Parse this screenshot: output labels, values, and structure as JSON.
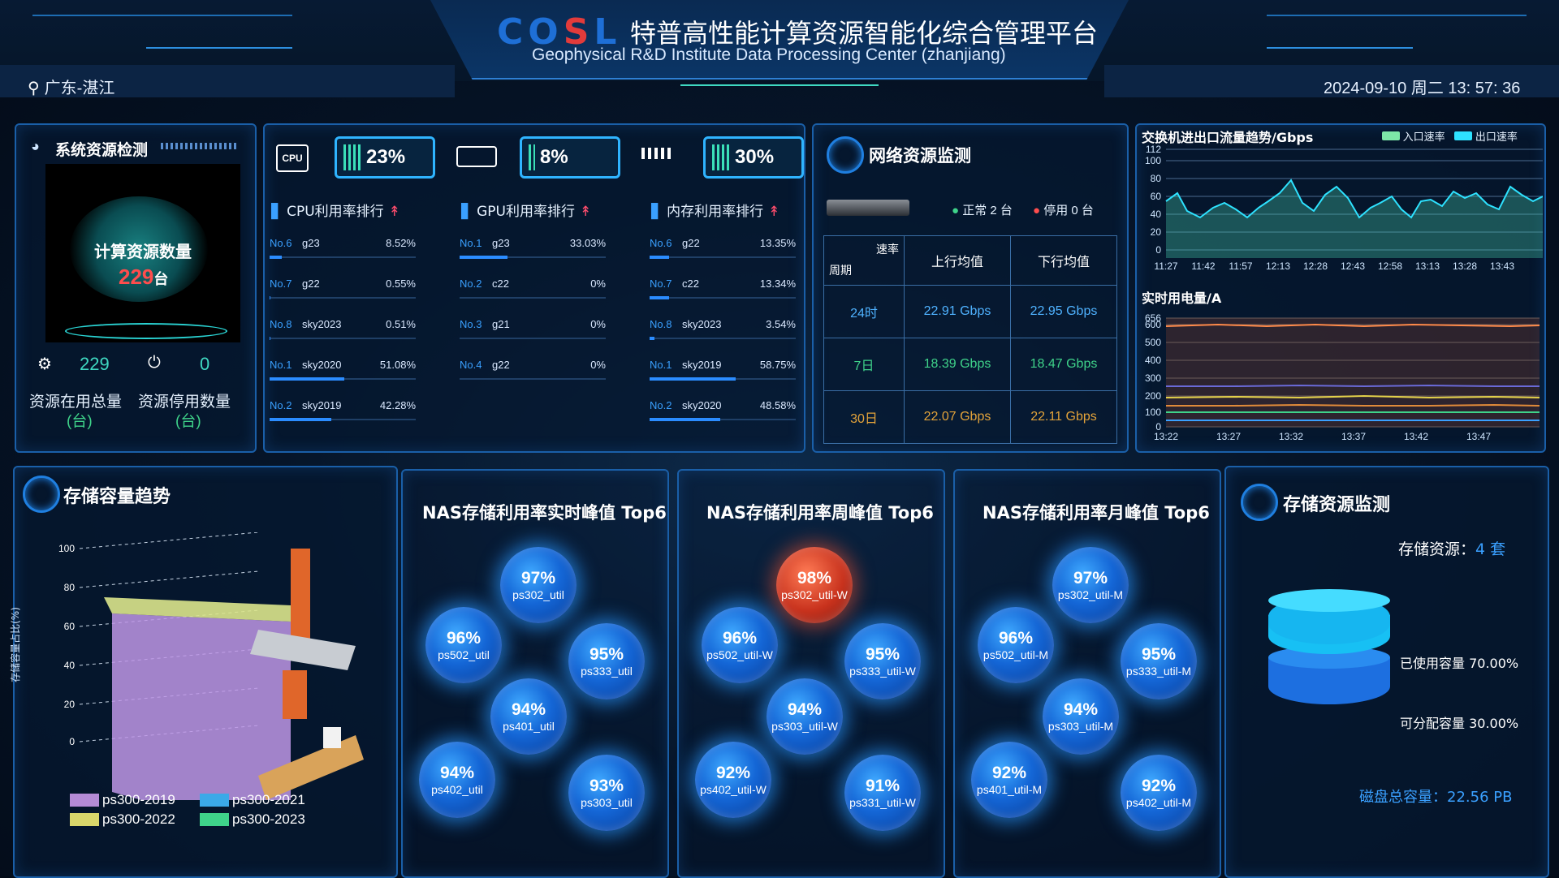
{
  "header": {
    "logo_main": "COSL",
    "title_cn": "特普高性能计算资源智能化综合管理平台",
    "title_en": "Geophysical R&D Institute Data Processing Center (zhanjiang)",
    "location": "广东-湛江",
    "datetime": "2024-09-10 周二 13: 57: 36"
  },
  "system_panel": {
    "title": "系统资源检测",
    "globe_label": "计算资源数量",
    "globe_count": "229",
    "globe_unit": "台",
    "in_use_value": "229",
    "stopped_value": "0",
    "in_use_label": "资源在用总量",
    "stopped_label": "资源停用数量",
    "unit_label": "(台)"
  },
  "metrics": {
    "cpu_icon_label": "CPU",
    "cpu_value": "23%",
    "gpu_value": "8%",
    "mem_value": "30%",
    "cpu_rank_title": "CPU利用率排行",
    "gpu_rank_title": "GPU利用率排行",
    "mem_rank_title": "内存利用率排行",
    "cpu_rank": [
      {
        "no": "No.6",
        "name": "g23",
        "pct": "8.52%",
        "fill": 8.52
      },
      {
        "no": "No.7",
        "name": "g22",
        "pct": "0.55%",
        "fill": 0.55
      },
      {
        "no": "No.8",
        "name": "sky2023",
        "pct": "0.51%",
        "fill": 0.51
      },
      {
        "no": "No.1",
        "name": "sky2020",
        "pct": "51.08%",
        "fill": 51.08
      },
      {
        "no": "No.2",
        "name": "sky2019",
        "pct": "42.28%",
        "fill": 42.28
      }
    ],
    "gpu_rank": [
      {
        "no": "No.1",
        "name": "g23",
        "pct": "33.03%",
        "fill": 33.03
      },
      {
        "no": "No.2",
        "name": "c22",
        "pct": "0%",
        "fill": 0
      },
      {
        "no": "No.3",
        "name": "g21",
        "pct": "0%",
        "fill": 0
      },
      {
        "no": "No.4",
        "name": "g22",
        "pct": "0%",
        "fill": 0
      }
    ],
    "mem_rank": [
      {
        "no": "No.6",
        "name": "g22",
        "pct": "13.35%",
        "fill": 13.35
      },
      {
        "no": "No.7",
        "name": "c22",
        "pct": "13.34%",
        "fill": 13.34
      },
      {
        "no": "No.8",
        "name": "sky2023",
        "pct": "3.54%",
        "fill": 3.54
      },
      {
        "no": "No.1",
        "name": "sky2019",
        "pct": "58.75%",
        "fill": 58.75
      },
      {
        "no": "No.2",
        "name": "sky2020",
        "pct": "48.58%",
        "fill": 48.58
      }
    ]
  },
  "network": {
    "title": "网络资源监测",
    "normal_label": "正常 2 台",
    "stopped_label": "停用 0 台",
    "table_corner_top": "速率",
    "table_corner_bottom": "周期",
    "col_up": "上行均值",
    "col_down": "下行均值",
    "rows": [
      {
        "period": "24时",
        "up": "22.91 Gbps",
        "down": "22.95 Gbps",
        "color": "#4fb2ff"
      },
      {
        "period": "7日",
        "up": "18.39 Gbps",
        "down": "18.47 Gbps",
        "color": "#3fd38a"
      },
      {
        "period": "30日",
        "up": "22.07 Gbps",
        "down": "22.11 Gbps",
        "color": "#e3a33a"
      }
    ]
  },
  "switch_chart": {
    "title": "交换机进出口流量趋势/Gbps",
    "legend_in": "入口速率",
    "legend_out": "出口速率",
    "y_ticks": [
      "112",
      "100",
      "80",
      "60",
      "40",
      "20",
      "0"
    ],
    "x_ticks": [
      "11:27",
      "11:42",
      "11:57",
      "12:13",
      "12:28",
      "12:43",
      "12:58",
      "13:13",
      "13:28",
      "13:43"
    ]
  },
  "power_chart": {
    "title": "实时用电量/A",
    "y_ticks": [
      "656",
      "600",
      "500",
      "400",
      "300",
      "200",
      "100",
      "0"
    ],
    "x_ticks": [
      "13:22",
      "13:27",
      "13:32",
      "13:37",
      "13:42",
      "13:47"
    ]
  },
  "storage_trend": {
    "title": "存储容量趋势",
    "y_label": "存储容量占比(%)",
    "y_ticks": [
      "100",
      "80",
      "60",
      "40",
      "20",
      "0"
    ],
    "legend": [
      {
        "name": "ps300-2019",
        "color": "#b58bd6"
      },
      {
        "name": "ps300-2021",
        "color": "#3ba9e8"
      },
      {
        "name": "ps300-2022",
        "color": "#d9d66a"
      },
      {
        "name": "ps300-2023",
        "color": "#3fd38a"
      }
    ]
  },
  "nas": {
    "realtime_title": "NAS存储利用率实时峰值 Top6",
    "weekly_title": "NAS存储利用率周峰值 Top6",
    "monthly_title": "NAS存储利用率月峰值 Top6",
    "realtime": [
      {
        "v": "97%",
        "n": "ps302_util"
      },
      {
        "v": "96%",
        "n": "ps502_util"
      },
      {
        "v": "95%",
        "n": "ps333_util"
      },
      {
        "v": "94%",
        "n": "ps401_util"
      },
      {
        "v": "94%",
        "n": "ps402_util"
      },
      {
        "v": "93%",
        "n": "ps303_util"
      }
    ],
    "weekly": [
      {
        "v": "98%",
        "n": "ps302_util-W"
      },
      {
        "v": "96%",
        "n": "ps502_util-W"
      },
      {
        "v": "95%",
        "n": "ps333_util-W"
      },
      {
        "v": "94%",
        "n": "ps303_util-W"
      },
      {
        "v": "92%",
        "n": "ps402_util-W"
      },
      {
        "v": "91%",
        "n": "ps331_util-W"
      }
    ],
    "monthly": [
      {
        "v": "97%",
        "n": "ps302_util-M"
      },
      {
        "v": "96%",
        "n": "ps502_util-M"
      },
      {
        "v": "95%",
        "n": "ps333_util-M"
      },
      {
        "v": "94%",
        "n": "ps303_util-M"
      },
      {
        "v": "92%",
        "n": "ps401_util-M"
      },
      {
        "v": "92%",
        "n": "ps402_util-M"
      }
    ]
  },
  "storage_monitor": {
    "title": "存储资源监测",
    "count_label": "存储资源：",
    "count_value": "4 套",
    "used_label": "已使用容量 70.00%",
    "avail_label": "可分配容量 30.00%",
    "total_label": "磁盘总容量：",
    "total_value": "22.56 PB"
  }
}
